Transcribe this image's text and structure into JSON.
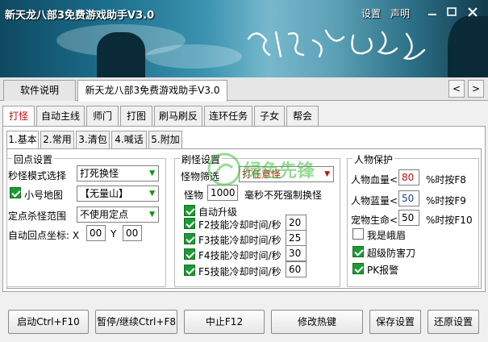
{
  "window": {
    "title": "新天龙八部3免费游戏助手V3.0",
    "settings_label": "设置",
    "statement_label": "声明",
    "minimize": "—",
    "maximize": "☐",
    "close": "✕"
  },
  "top_tabs": [
    {
      "label": "软件说明"
    },
    {
      "label": "新天龙八部3免费游戏助手V3.0"
    }
  ],
  "scroll": {
    "left": "<",
    "right": ">"
  },
  "main_tabs": [
    {
      "label": "打怪"
    },
    {
      "label": "自动主线"
    },
    {
      "label": "师门"
    },
    {
      "label": "打图"
    },
    {
      "label": "刷马刷反"
    },
    {
      "label": "连环任务"
    },
    {
      "label": "子女"
    },
    {
      "label": "帮会"
    }
  ],
  "sub_tabs": [
    {
      "label": "1.基本"
    },
    {
      "label": "2.常用"
    },
    {
      "label": "3.清包"
    },
    {
      "label": "4.喊话"
    },
    {
      "label": "5.附加"
    }
  ],
  "respawn": {
    "title": "回点设置",
    "mode_label": "秒怪模式选择",
    "mode_value": "打死换怪",
    "minimap_label": "小号地图",
    "minimap_checked": true,
    "map_value": "【无量山】",
    "range_label": "定点杀怪范围",
    "range_value": "不使用定点",
    "coord_label": "自动回点坐标: X",
    "coord_y_label": "Y",
    "coord_x": "00",
    "coord_y": "00"
  },
  "fight": {
    "title": "刷怪设置",
    "filter_label": "怪物筛选",
    "filter_value": "打任意怪",
    "monster_label": "怪物",
    "monster_ms": "1000",
    "monster_suffix": "毫秒不死强制换怪",
    "auto_upgrade_label": "自动升级",
    "auto_upgrade_checked": true,
    "skills": [
      {
        "label": "F2技能冷却时间/秒",
        "value": "20",
        "checked": true
      },
      {
        "label": "F3技能冷却时间/秒",
        "value": "25",
        "checked": true
      },
      {
        "label": "F4技能冷却时间/秒",
        "value": "30",
        "checked": true
      },
      {
        "label": "F5技能冷却时间/秒",
        "value": "60",
        "checked": true
      }
    ]
  },
  "protect": {
    "title": "人物保护",
    "hp_label": "人物血量<",
    "hp_value": "80",
    "hp_key": "%时按F8",
    "mp_label": "人物蓝量<",
    "mp_value": "50",
    "mp_key": "%时按F9",
    "pet_label": "宠物生命<",
    "pet_value": "50",
    "pet_key": "%时按F10",
    "emei_label": "我是峨眉",
    "emei_checked": false,
    "superdef_label": "超级防害刀",
    "superdef_checked": true,
    "pk_label": "PK报警",
    "pk_checked": true
  },
  "buttons": {
    "start": "启动Ctrl+F10",
    "pause": "暂停/继续Ctrl+F8",
    "stop": "中止F12",
    "hotkey": "修改热键",
    "save": "保存设置",
    "restore": "还原设置"
  },
  "watermark": {
    "text": "绿色先锋"
  },
  "colors": {
    "accent_red": "#c01010",
    "check_green": "#1c9a35",
    "banner": "#1b6e8c"
  }
}
